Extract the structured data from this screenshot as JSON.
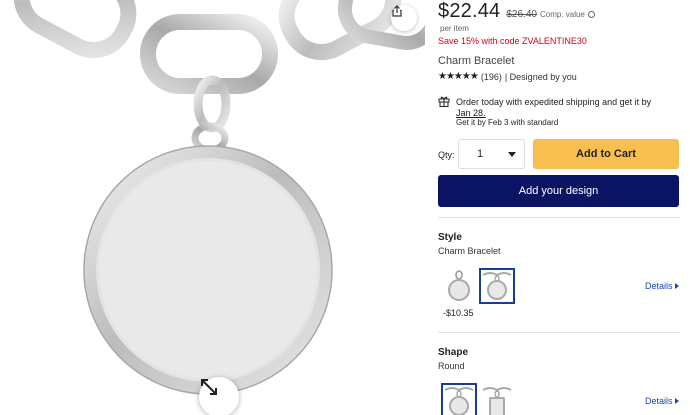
{
  "product": {
    "price": "$22.44",
    "old_price": "$26.40",
    "comp_label": "Comp. value",
    "per_item": "per item",
    "promo": "Save 15% with code ZVALENTINE30",
    "name": "Charm Bracelet",
    "stars": "★★★★★",
    "reviews": "(196)",
    "designed_by": "| Designed by you"
  },
  "shipping": {
    "line1": "Order today with expedited shipping and get it by",
    "date": "Jan 28",
    "date_suffix": ".",
    "standard": "Get it by Feb 3 with standard"
  },
  "purchase": {
    "qty_label": "Qty:",
    "qty_value": "1",
    "add_to_cart": "Add to Cart",
    "add_design": "Add your design"
  },
  "style_option": {
    "title": "Style",
    "value": "Charm Bracelet",
    "alt_price": "-$10.35",
    "details": "Details"
  },
  "shape_option": {
    "title": "Shape",
    "value": "Round",
    "details": "Details"
  },
  "colors": {
    "accent_yellow": "#f6bf4f",
    "navy": "#0b1463",
    "promo_red": "#d0021b",
    "link_blue": "#1a47b8",
    "selected_border": "#1a3d8f"
  },
  "icons": [
    "share-icon",
    "expand-icon",
    "info-icon",
    "gift-icon",
    "chevron-down-icon",
    "chevron-right-icon"
  ]
}
